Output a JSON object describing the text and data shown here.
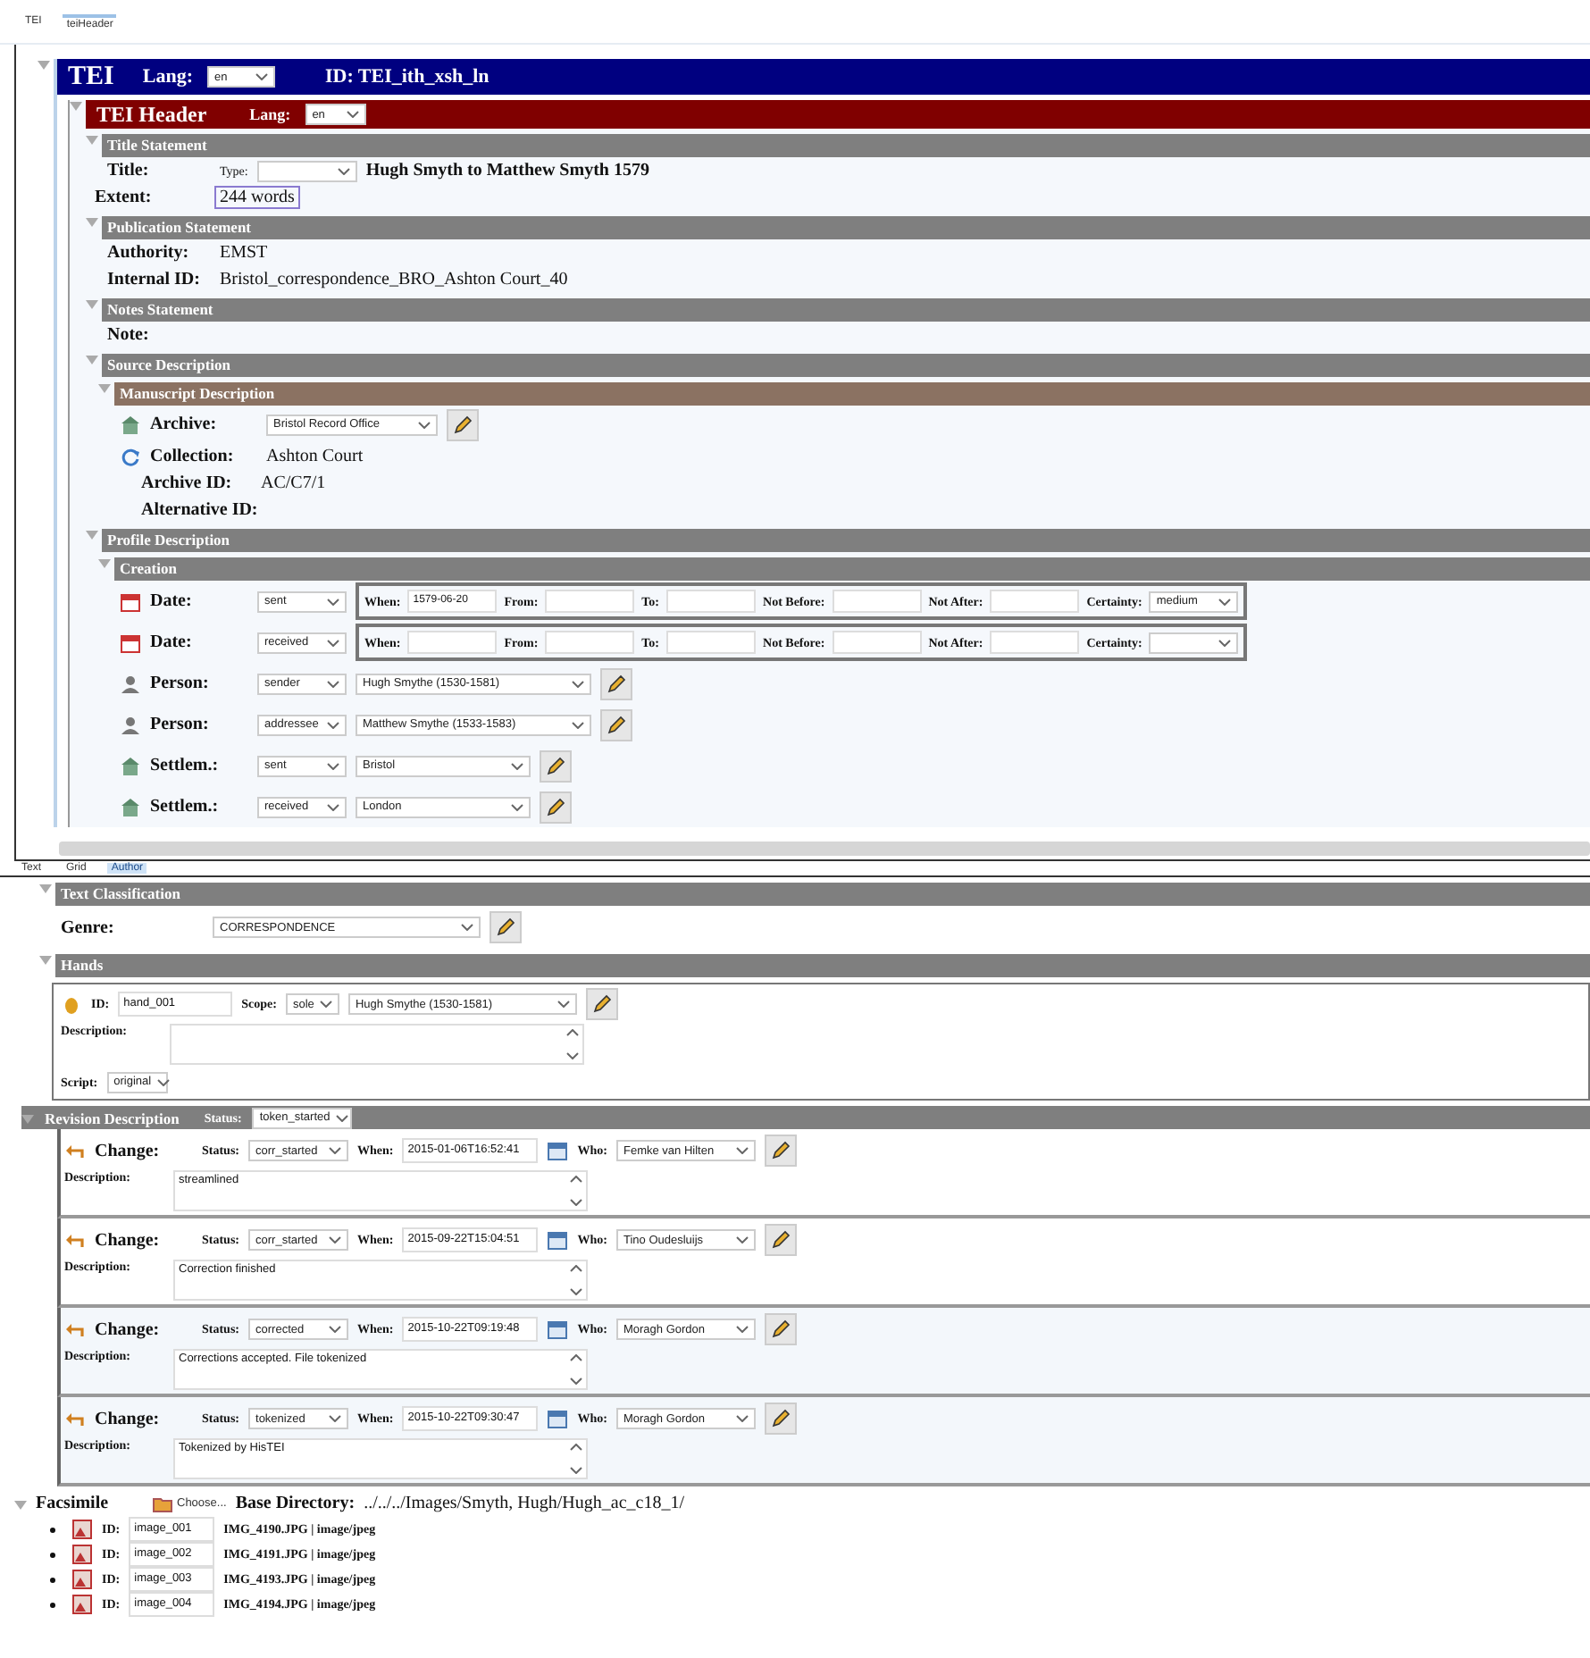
{
  "breadcrumb": [
    {
      "label": "TEI",
      "selected": false
    },
    {
      "label": "teiHeader",
      "selected": true
    }
  ],
  "tei": {
    "title": "TEI",
    "lang_label": "Lang:",
    "lang": "en",
    "id_label": "ID: TEI_ith_xsh_ln"
  },
  "header": {
    "title": "TEI Header",
    "lang_label": "Lang:",
    "lang": "en"
  },
  "title_statement": {
    "heading": "Title Statement",
    "title_label": "Title:",
    "type_label": "Type:",
    "title": "Hugh Smyth to Matthew Smyth 1579",
    "extent_label": "Extent:",
    "extent": "244 words"
  },
  "publication": {
    "heading": "Publication Statement",
    "fields": [
      {
        "label": "Authority:",
        "value": "EMST"
      },
      {
        "label": "Internal ID:",
        "value": "Bristol_correspondence_BRO_Ashton Court_40"
      }
    ]
  },
  "notes": {
    "heading": "Notes Statement",
    "note_label": "Note:"
  },
  "source": {
    "heading": "Source Description",
    "manuscript": {
      "heading": "Manuscript Description",
      "fields": [
        {
          "kind": "archive",
          "label": "Archive:",
          "value": "Bristol Record Office"
        },
        {
          "kind": "collection",
          "label": "Collection:",
          "value": "Ashton Court"
        },
        {
          "kind": "plain",
          "label": "Archive ID:",
          "value": "AC/C7/1"
        },
        {
          "kind": "plain",
          "label": "Alternative ID:"
        }
      ]
    }
  },
  "profile": {
    "heading": "Profile Description",
    "creation": {
      "heading": "Creation",
      "rows": [
        {
          "kind": "date",
          "label": "Date:",
          "type": "sent",
          "fields": [
            {
              "label": "When:",
              "value": "1579-06-20"
            },
            {
              "label": "From:"
            },
            {
              "label": "To:"
            },
            {
              "label": "Not Before:"
            },
            {
              "label": "Not After:"
            }
          ],
          "certainty_label": "Certainty:",
          "certainty": "medium"
        },
        {
          "kind": "date",
          "label": "Date:",
          "type": "received",
          "fields": [
            {
              "label": "When:"
            },
            {
              "label": "From:"
            },
            {
              "label": "To:"
            },
            {
              "label": "Not Before:"
            },
            {
              "label": "Not After:"
            }
          ],
          "certainty_label": "Certainty:"
        },
        {
          "kind": "person",
          "label": "Person:",
          "type": "sender",
          "value": "Hugh Smythe (1530-1581)"
        },
        {
          "kind": "person",
          "label": "Person:",
          "type": "addressee",
          "value": "Matthew Smythe (1533-1583)"
        },
        {
          "kind": "settlement",
          "label": "Settlem.:",
          "type": "sent",
          "value": "Bristol"
        },
        {
          "kind": "settlement",
          "label": "Settlem.:",
          "type": "received",
          "value": "London"
        }
      ]
    }
  },
  "view_tabs": [
    {
      "label": "Text",
      "selected": false
    },
    {
      "label": "Grid",
      "selected": false
    },
    {
      "label": "Author",
      "selected": true
    }
  ],
  "text_classification": {
    "heading": "Text Classification",
    "genre_label": "Genre:",
    "genre": "CORRESPONDENCE"
  },
  "hands": {
    "heading": "Hands",
    "items": [
      {
        "id_label": "ID:",
        "id": "hand_001",
        "scope_label": "Scope:",
        "scope": "sole",
        "person": "Hugh Smythe (1530-1581)",
        "description_label": "Description:",
        "script_label": "Script:",
        "script": "original"
      }
    ]
  },
  "revision": {
    "heading": "Revision Description",
    "status_label": "Status:",
    "status": "token_started",
    "changes": [
      {
        "label": "Change:",
        "status_label": "Status:",
        "status": "corr_started",
        "when_label": "When:",
        "when": "2015-01-06T16:52:41",
        "who_label": "Who:",
        "who": "Femke van Hilten",
        "description_label": "Description:",
        "description": "streamlined"
      },
      {
        "label": "Change:",
        "status_label": "Status:",
        "status": "corr_started",
        "when_label": "When:",
        "when": "2015-09-22T15:04:51",
        "who_label": "Who:",
        "who": "Tino Oudesluijs",
        "description_label": "Description:",
        "description": "Correction finished"
      },
      {
        "label": "Change:",
        "status_label": "Status:",
        "status": "corrected",
        "when_label": "When:",
        "when": "2015-10-22T09:19:48",
        "who_label": "Who:",
        "who": "Moragh Gordon",
        "description_label": "Description:",
        "description": "Corrections accepted. File tokenized"
      },
      {
        "label": "Change:",
        "status_label": "Status:",
        "status": "tokenized",
        "when_label": "When:",
        "when": "2015-10-22T09:30:47",
        "who_label": "Who:",
        "who": "Moragh Gordon",
        "description_label": "Description:",
        "description": "Tokenized by HisTEI"
      }
    ]
  },
  "facsimile": {
    "heading": "Facsimile",
    "choose": "Choose...",
    "base_label": "Base Directory:",
    "base": "../../../Images/Smyth, Hugh/Hugh_ac_c18_1/",
    "images": [
      {
        "id_label": "ID:",
        "id": "image_001",
        "file": "IMG_4190.JPG | image/jpeg"
      },
      {
        "id_label": "ID:",
        "id": "image_002",
        "file": "IMG_4191.JPG | image/jpeg"
      },
      {
        "id_label": "ID:",
        "id": "image_003",
        "file": "IMG_4193.JPG | image/jpeg"
      },
      {
        "id_label": "ID:",
        "id": "image_004",
        "file": "IMG_4194.JPG | image/jpeg"
      }
    ]
  }
}
